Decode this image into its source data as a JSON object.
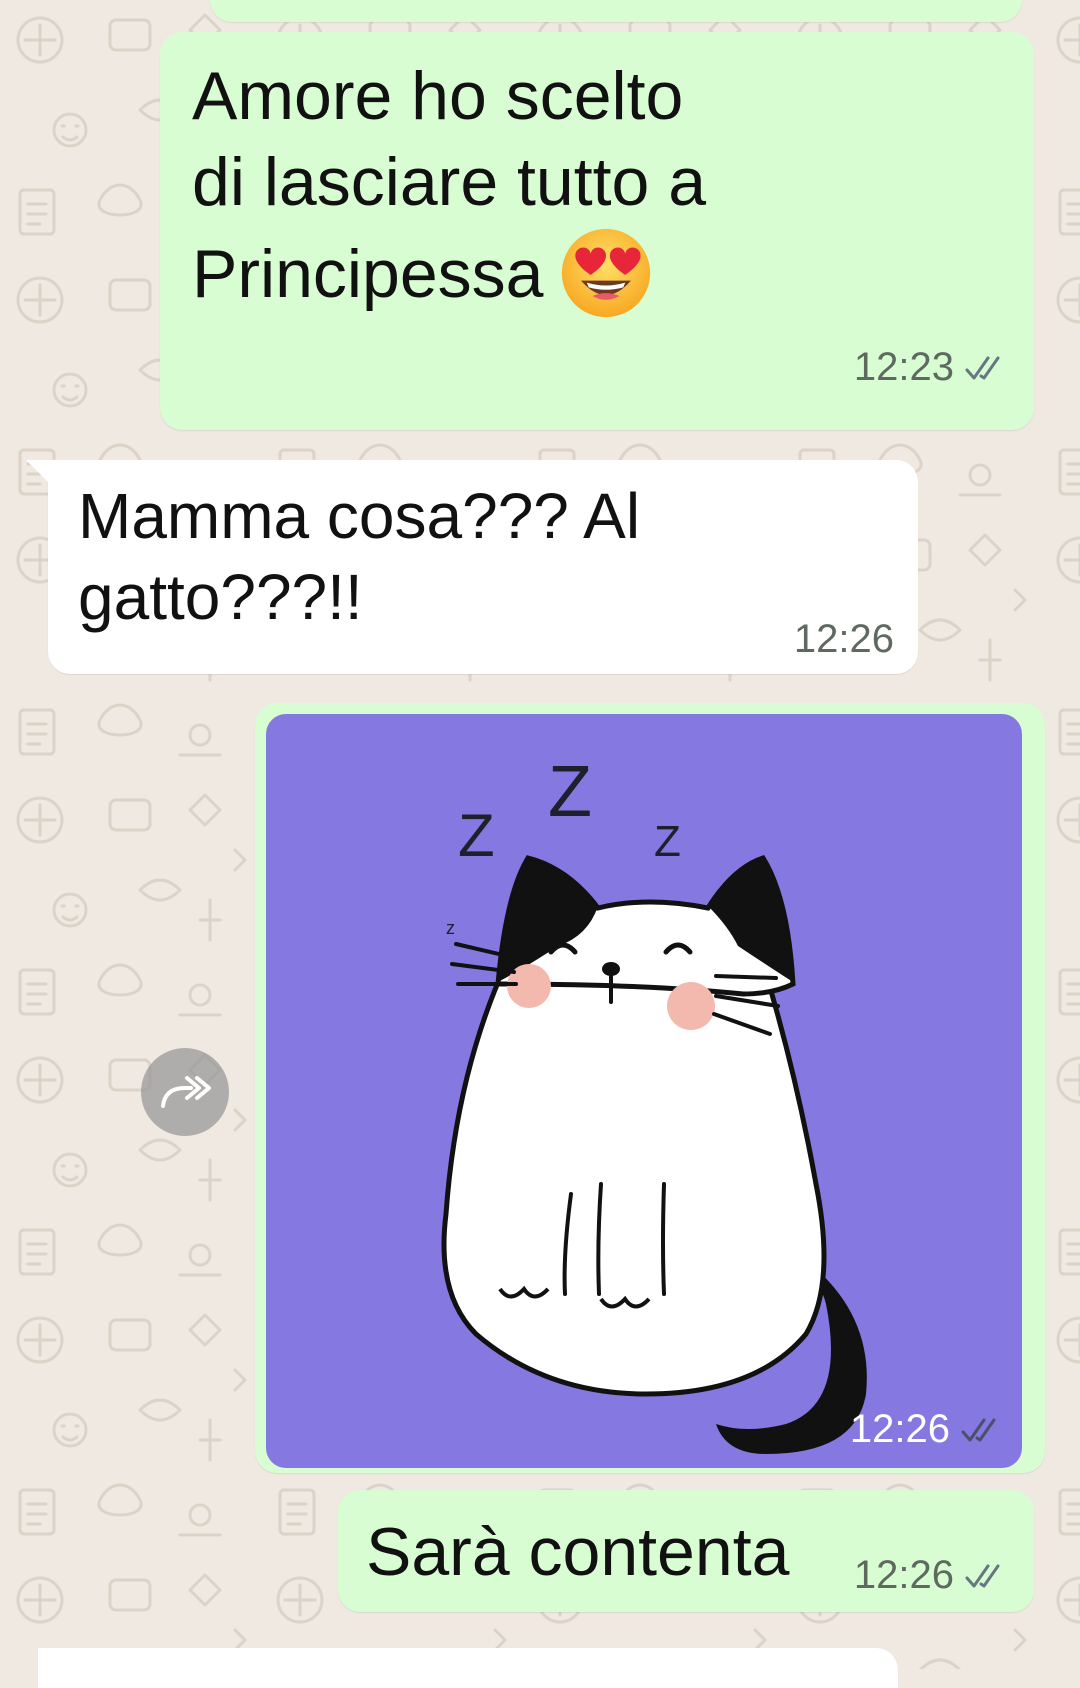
{
  "chat": {
    "messages": [
      {
        "direction": "outgoing",
        "lines": [
          "Amore ho scelto",
          "di lasciare tutto a",
          "Principessa"
        ],
        "emoji": "heart-eyes-emoji",
        "time": "12:23",
        "status": "read"
      },
      {
        "direction": "incoming",
        "lines": [
          "Mamma cosa??? Al",
          "gatto???!!"
        ],
        "time": "12:26"
      },
      {
        "direction": "outgoing",
        "type": "sticker",
        "sticker": "sleeping-cat-sticker",
        "sleep_letters": [
          "Z",
          "Z",
          "Z",
          "z"
        ],
        "time": "12:26",
        "status": "read"
      },
      {
        "direction": "outgoing",
        "text": "Sarà contenta",
        "time": "12:26",
        "status": "read"
      }
    ],
    "forward_icon": "forward-icon"
  },
  "colors": {
    "wallpaper": "#efe9e1",
    "outgoing_bubble": "#d9fdd3",
    "incoming_bubble": "#ffffff",
    "sticker_background": "#8578e0",
    "read_ticks": "#667781"
  }
}
